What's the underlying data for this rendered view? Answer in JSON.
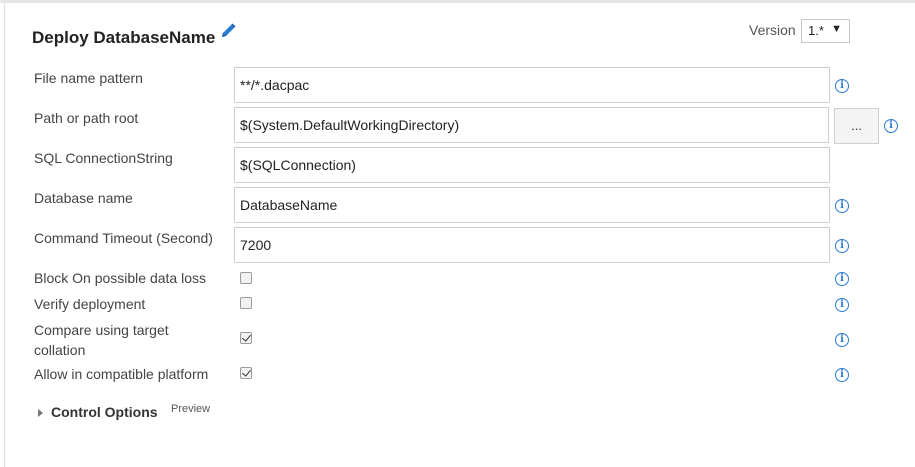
{
  "task": {
    "title": "Deploy DatabaseName",
    "version_label": "Version",
    "version_value": "1.*"
  },
  "fields": {
    "file_name_pattern": {
      "label": "File name pattern",
      "value": "**/*.dacpac"
    },
    "path_root": {
      "label": "Path or path root",
      "value": "$(System.DefaultWorkingDirectory)",
      "browse_label": "..."
    },
    "sql_connection": {
      "label": "SQL ConnectionString",
      "value": "$(SQLConnection)"
    },
    "database_name": {
      "label": "Database name",
      "value": "DatabaseName"
    },
    "command_timeout": {
      "label": "Command Timeout (Second)",
      "value": "7200"
    }
  },
  "options": {
    "block_data_loss": {
      "label": "Block On possible data loss",
      "checked": false
    },
    "verify_deployment": {
      "label": "Verify deployment",
      "checked": false
    },
    "compare_collation": {
      "label_line1": "Compare using target",
      "label_line2": "collation",
      "checked": true
    },
    "compatible_platform": {
      "label": "Allow in compatible platform",
      "checked": true
    }
  },
  "control_options": {
    "label": "Control Options",
    "badge": "Preview"
  },
  "icons": {
    "info": "i",
    "edit": "pencil-icon",
    "expand": "triangle-right-icon"
  },
  "colors": {
    "accent": "#2a7ad4",
    "border": "#cfcfcf"
  }
}
